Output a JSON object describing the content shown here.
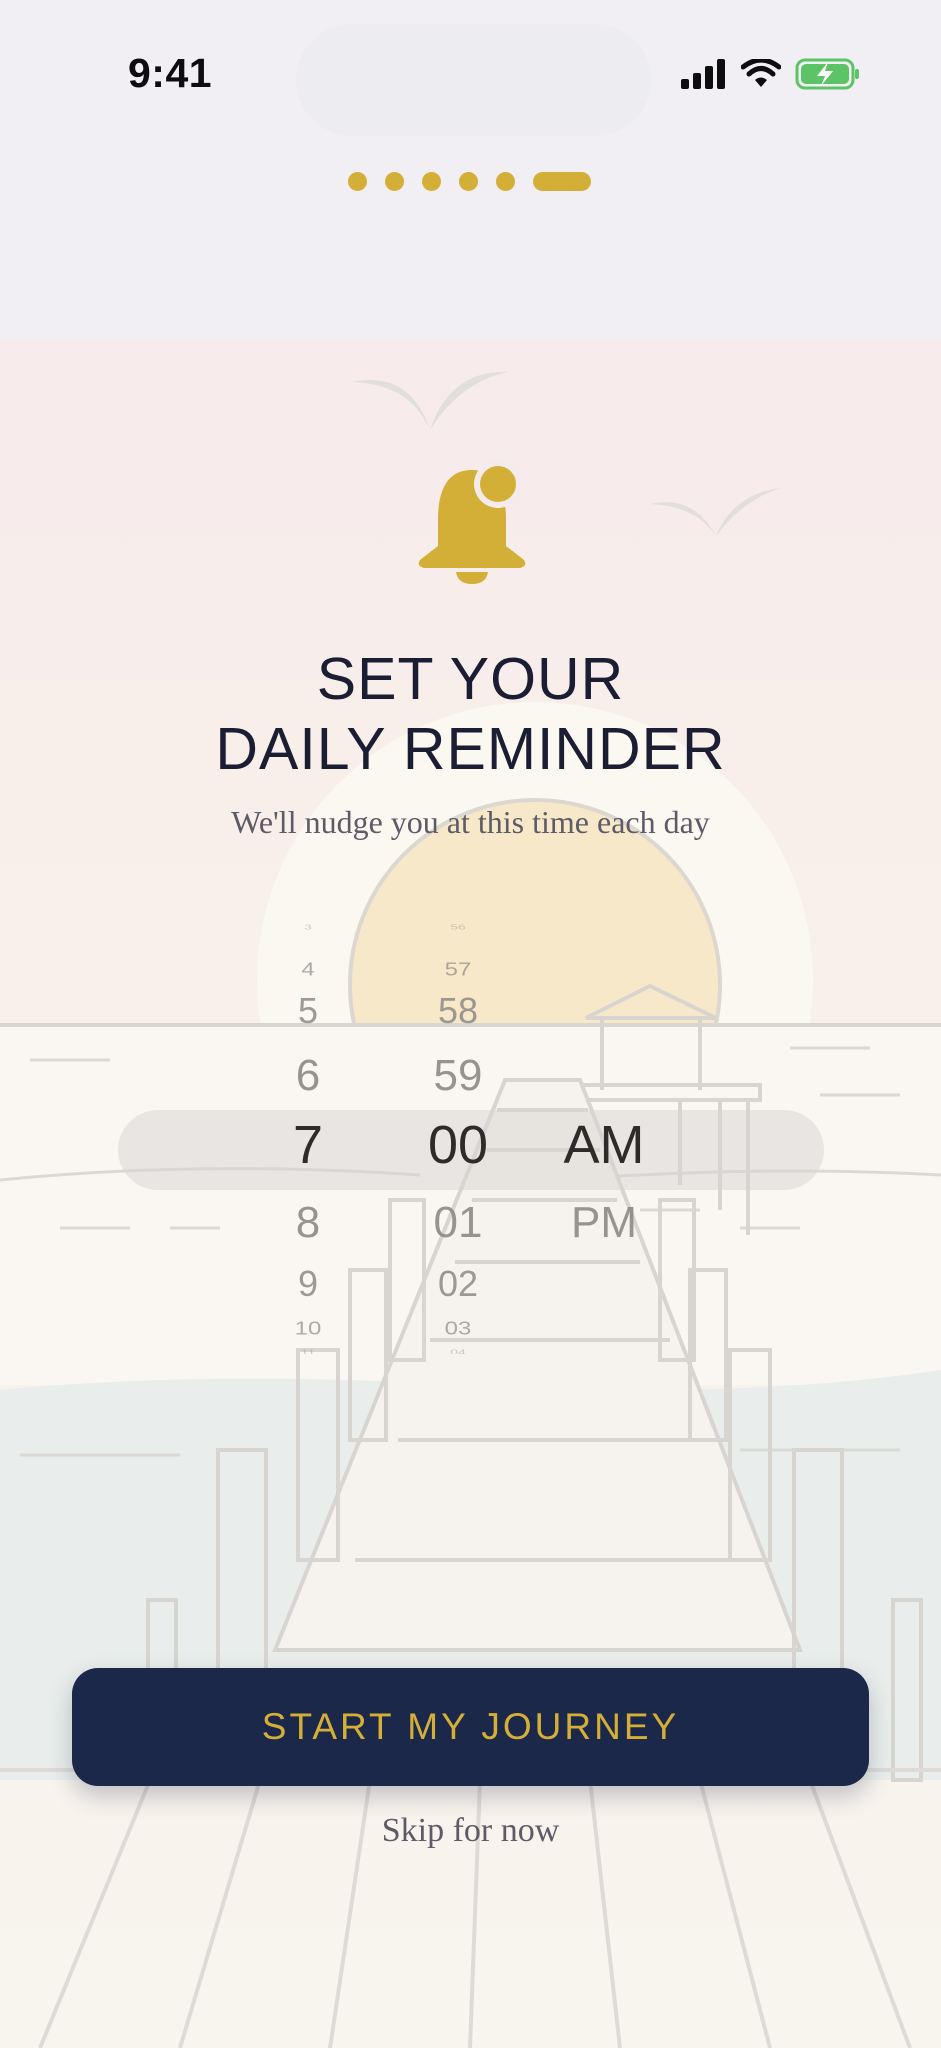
{
  "status_bar": {
    "time": "9:41"
  },
  "onboarding": {
    "total_steps": 6,
    "current_step": 6
  },
  "header": {
    "title_line1": "SET YOUR",
    "title_line2": "DAILY REMINDER",
    "subtitle": "We'll nudge you at this time each day"
  },
  "time_picker": {
    "hour": {
      "items": [
        "3",
        "4",
        "5",
        "6",
        "7",
        "8",
        "9",
        "10",
        "11"
      ],
      "selected": "7"
    },
    "minute": {
      "items": [
        "56",
        "57",
        "58",
        "59",
        "00",
        "01",
        "02",
        "03",
        "04"
      ],
      "selected": "00"
    },
    "period": {
      "items": [
        "AM",
        "PM"
      ],
      "selected": "AM"
    }
  },
  "actions": {
    "primary_label": "START MY JOURNEY",
    "skip_label": "Skip for now"
  },
  "colors": {
    "accent_gold": "#d4af37",
    "navy": "#1c2849",
    "title_text": "#1b1d33",
    "background": "#f1eff4"
  },
  "icons": [
    "bell-icon",
    "cellular-signal-icon",
    "wifi-icon",
    "battery-charging-icon",
    "bird-icon"
  ]
}
